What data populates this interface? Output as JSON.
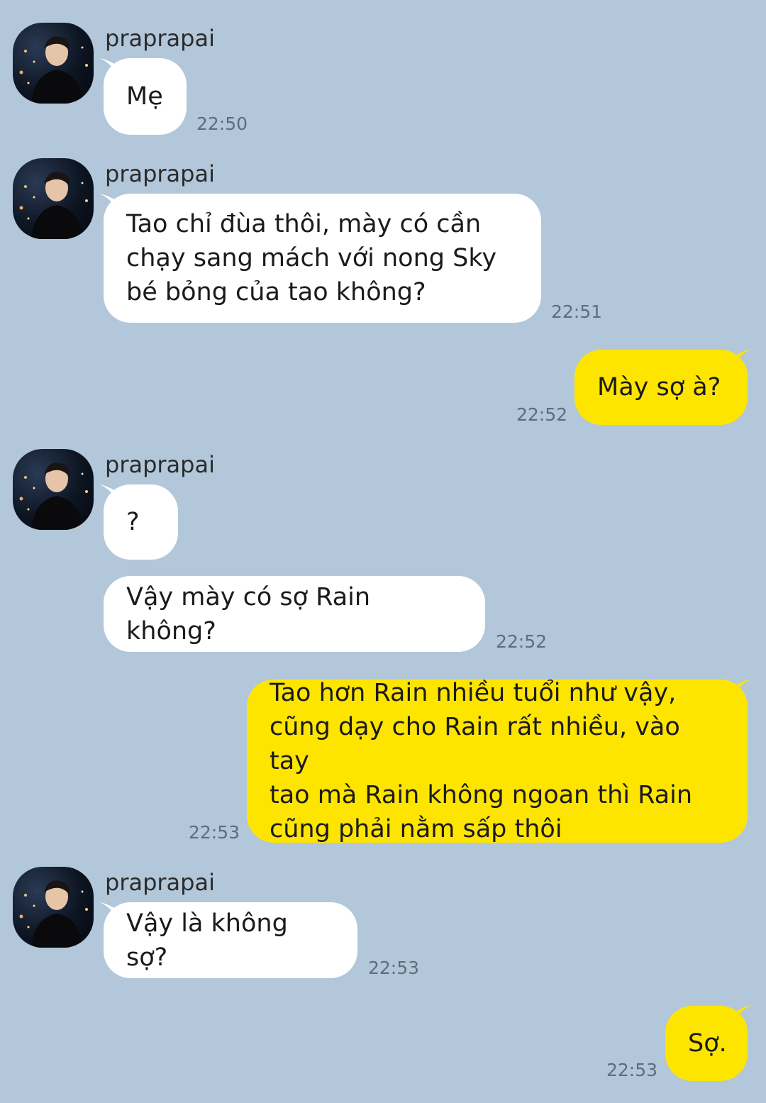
{
  "chat": {
    "sender_name": "praprapai",
    "messages": [
      {
        "text": "Mẹ",
        "time": "22:50"
      },
      {
        "text": "Tao chỉ đùa thôi, mày có cần\nchạy sang mách với nong Sky\nbé bỏng của tao không?",
        "time": "22:51"
      },
      {
        "text": "Mày sợ à?",
        "time": "22:52"
      },
      {
        "text": "?",
        "time": ""
      },
      {
        "text": "Vậy mày có sợ Rain không?",
        "time": "22:52"
      },
      {
        "text": "Tao hơn Rain nhiều tuổi như vậy,\ncũng dạy cho Rain rất nhiều, vào tay\ntao mà Rain không ngoan thì Rain\ncũng phải nằm sấp thôi",
        "time": "22:53"
      },
      {
        "text": "Vậy là không sợ?",
        "time": "22:53"
      },
      {
        "text": "Sợ.",
        "time": "22:53"
      }
    ]
  },
  "colors": {
    "background": "#b2c7da",
    "incoming_bubble": "#ffffff",
    "outgoing_bubble": "#fee500"
  },
  "icons": {
    "avatar": "profile-photo"
  }
}
